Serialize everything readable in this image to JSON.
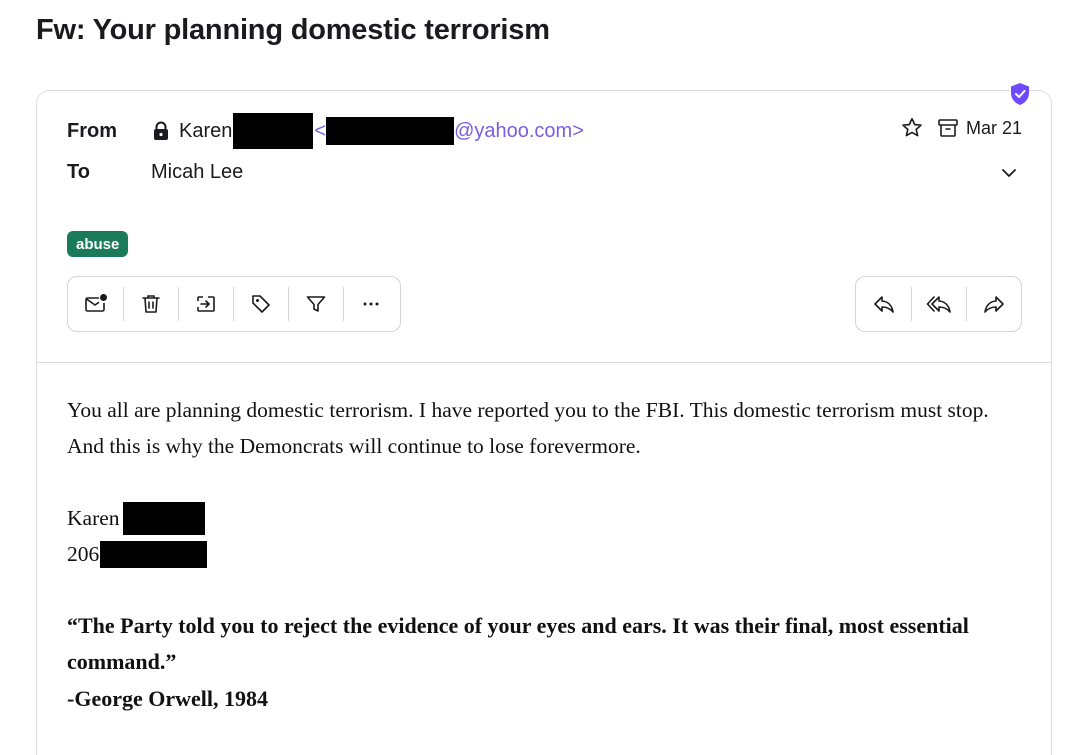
{
  "subject": "Fw: Your planning domestic terrorism",
  "header": {
    "from_label": "From",
    "to_label": "To",
    "sender_first_name": "Karen",
    "sender_email_open": "<",
    "sender_email_domain": "@yahoo.com>",
    "recipient": "Micah Lee",
    "date": "Mar 21"
  },
  "labels": [
    "abuse"
  ],
  "toolbar_left": [
    {
      "name": "mark-unread-icon"
    },
    {
      "name": "trash-icon"
    },
    {
      "name": "move-to-icon"
    },
    {
      "name": "label-icon"
    },
    {
      "name": "filter-icon"
    },
    {
      "name": "more-icon"
    }
  ],
  "toolbar_right": [
    {
      "name": "reply-icon"
    },
    {
      "name": "reply-all-icon"
    },
    {
      "name": "forward-icon"
    }
  ],
  "body": {
    "paragraph": "You all are planning domestic terrorism.  I have reported you to the FBI.  This domestic terrorism must stop.  And this is why the Demoncrats will continue to lose forevermore.",
    "signature_name": "Karen",
    "signature_phone_prefix": "206-",
    "quote_line": "“The Party told you to reject the evidence of your eyes and ears. It was their final, most essential command.”",
    "quote_attribution": "-George Orwell, 1984"
  },
  "colors": {
    "accent": "#7c5ce0",
    "tag_bg": "#1b7a5a",
    "shield": "#6d4aff"
  }
}
